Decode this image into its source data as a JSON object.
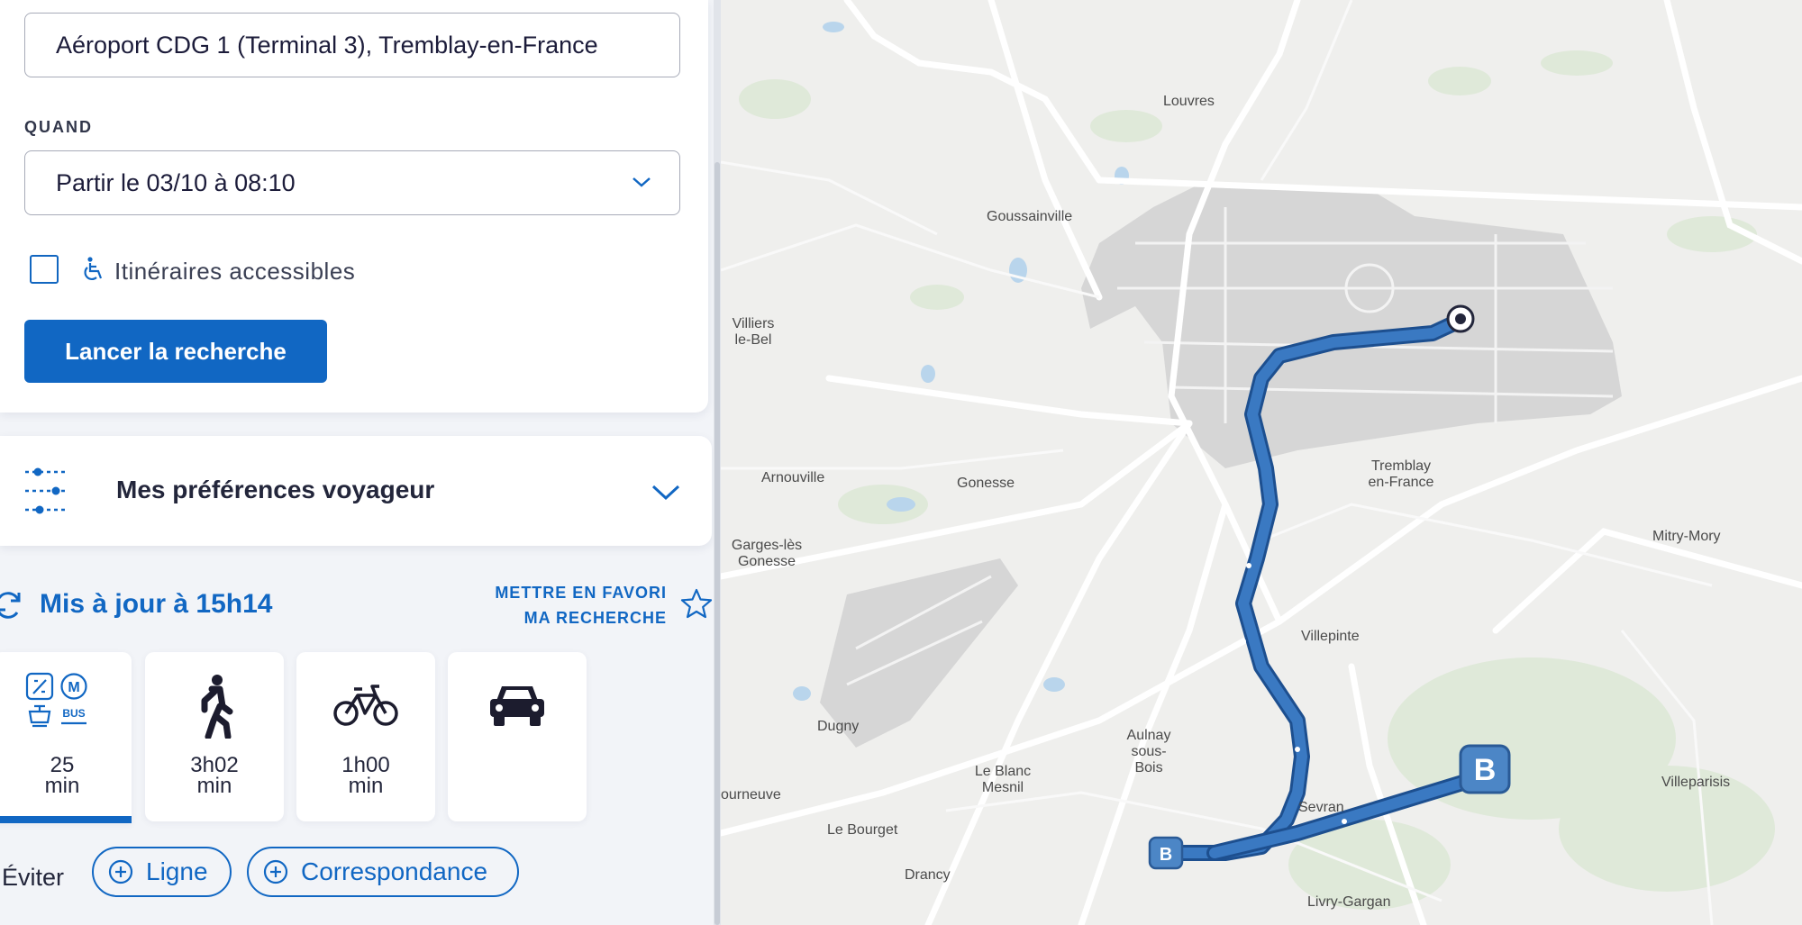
{
  "search": {
    "from_value": "Aéroport CDG 1 (Terminal 3), Tremblay-en-France",
    "when_label": "QUAND",
    "when_value": "Partir le 03/10 à 08:10",
    "accessible_label": "Itinéraires accessibles",
    "accessible_checked": false,
    "search_button": "Lancer la recherche"
  },
  "preferences": {
    "label": "Mes préférences voyageur"
  },
  "results": {
    "updated": "Mis à jour à 15h14",
    "favorite_line1": "METTRE EN FAVORI",
    "favorite_line2": "MA RECHERCHE",
    "modes": [
      {
        "name": "transit",
        "duration": "25",
        "unit": "min",
        "selected": true,
        "icons": [
          "RER/train-icon",
          "metro-M-icon",
          "tram-icon",
          "bus-icon"
        ],
        "bus_text": "BUS",
        "metro_text": "M"
      },
      {
        "name": "walk",
        "duration": "3h02",
        "unit": "min",
        "selected": false
      },
      {
        "name": "bike",
        "duration": "1h00",
        "unit": "min",
        "selected": false
      },
      {
        "name": "car",
        "duration": "",
        "unit": "",
        "selected": false
      }
    ],
    "avoid_label": "Éviter",
    "avoid_buttons": [
      "Ligne",
      "Correspondance"
    ]
  },
  "map": {
    "places": [
      "Louvres",
      "Goussainville",
      "Villiers le-Bel",
      "Arnouville",
      "Gonesse",
      "Tremblay en-France",
      "Mitry-Mory",
      "Garges-lès Gonesse",
      "Villepinte",
      "Dugny",
      "Aulnay sous-Bois",
      "Le Blanc Mesnil",
      "Villeparisis",
      "Sevran",
      "ourneuve",
      "Le Bourget",
      "Drancy",
      "Livry-Gargan"
    ],
    "markers": [
      "B",
      "B"
    ],
    "colors": {
      "route": "#3a79c2",
      "route_outline": "#1d4f8f",
      "accent": "#1167c3"
    }
  }
}
